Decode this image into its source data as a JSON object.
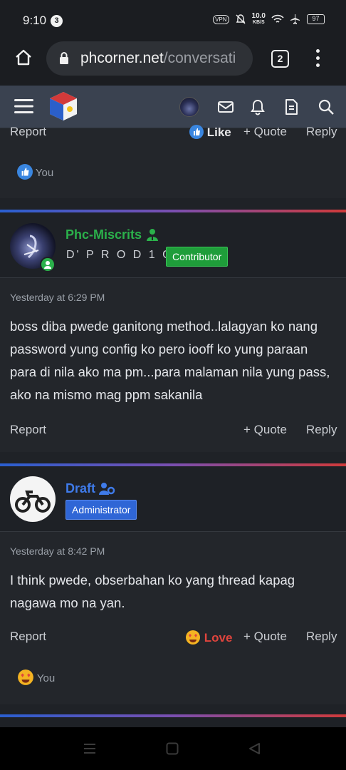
{
  "status_bar": {
    "time": "9:10",
    "notification_count": "3",
    "vpn": "VPN",
    "net_speed": "10.0",
    "net_unit": "KB/S",
    "battery": "97"
  },
  "browser": {
    "domain": "phcorner.net",
    "path": "/conversati",
    "tab_count": "2"
  },
  "partial_post": {
    "report": "Report",
    "like": "Like",
    "quote": "Quote",
    "reply": "Reply",
    "reacted_by": "You"
  },
  "posts": [
    {
      "username": "Phc-Miscrits",
      "title": "D' P R O D 1 G Y",
      "banner": "Contributor",
      "date": "Yesterday at 6:29 PM",
      "message": "boss diba pwede ganitong method..lalagyan ko nang password yung config ko pero iooff ko yung paraan para di nila ako ma pm...para malaman nila yung pass, ako na mismo mag ppm sakanila",
      "report": "Report",
      "quote": "Quote",
      "reply": "Reply"
    },
    {
      "username": "Draft",
      "banner": "Administrator",
      "date": "Yesterday at 8:42 PM",
      "message": "I think pwede, obserbahan ko yang thread kapag nagawa mo na yan.",
      "report": "Report",
      "love": "Love",
      "quote": "Quote",
      "reply": "Reply",
      "reacted_by": "You"
    }
  ],
  "colors": {
    "contributor_banner": "#1f9d3a",
    "admin_banner": "#2f66d6",
    "miscrits_name": "#2bb14b",
    "draft_name": "#3f7bea",
    "love": "#e0443d",
    "like": "#3a86e0"
  }
}
